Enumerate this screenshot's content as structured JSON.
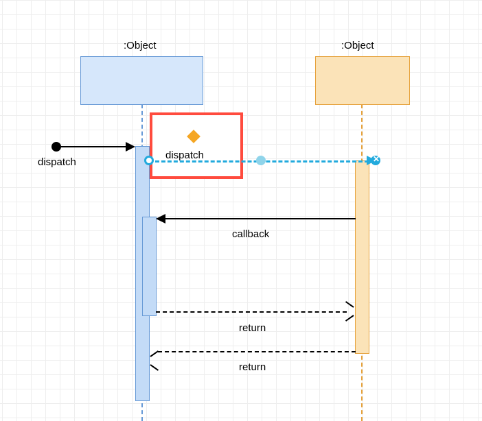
{
  "diagram_type": "uml_sequence_diagram",
  "objects": [
    {
      "id": "obj1",
      "label": ":Object",
      "color": "blue"
    },
    {
      "id": "obj2",
      "label": ":Object",
      "color": "orange"
    }
  ],
  "messages": {
    "found_dispatch": {
      "label": "dispatch",
      "type": "found-sync",
      "to": "obj1"
    },
    "dispatch_selected": {
      "label": "dispatch",
      "type": "sync",
      "from": "obj1",
      "to": "obj2",
      "selected": true
    },
    "callback": {
      "label": "callback",
      "type": "sync",
      "from": "obj2",
      "to": "obj1"
    },
    "return_inner": {
      "label": "return",
      "type": "return",
      "from": "obj1",
      "to": "obj2"
    },
    "return_outer": {
      "label": "return",
      "type": "return",
      "from": "obj2",
      "to": "obj1"
    }
  },
  "ui": {
    "selection_handle_start": "start-handle",
    "selection_handle_mid": "mid-handle",
    "selection_handle_end": "end-handle"
  }
}
